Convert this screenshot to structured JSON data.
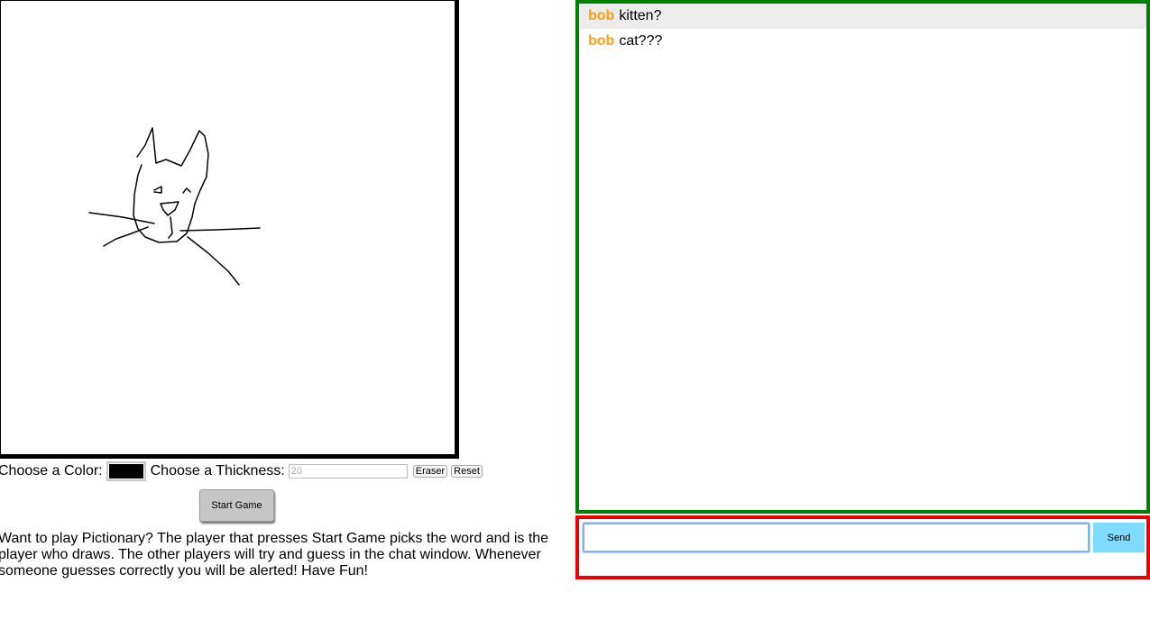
{
  "controls": {
    "color_label": "Choose a Color:",
    "color_value": "#000000",
    "thickness_label": "Choose a Thickness:",
    "thickness_placeholder": "20",
    "eraser_label": "Eraser",
    "reset_label": "Reset"
  },
  "start_button": "Start Game",
  "instructions": "Want to play Pictionary? The player that presses Start Game picks the word and is the player who draws. The other players will try and guess in the chat window. Whenever someone guesses correctly you will be alerted! Have Fun!",
  "chat": {
    "messages": [
      {
        "user": "bob",
        "text": "kitten?"
      },
      {
        "user": "bob",
        "text": "cat???"
      }
    ]
  },
  "send": {
    "input_value": "",
    "button_label": "Send"
  },
  "colors": {
    "chat_border": "#008000",
    "send_border": "#ee0000",
    "username": "#ff9f1a",
    "send_button": "#7fdbff"
  }
}
